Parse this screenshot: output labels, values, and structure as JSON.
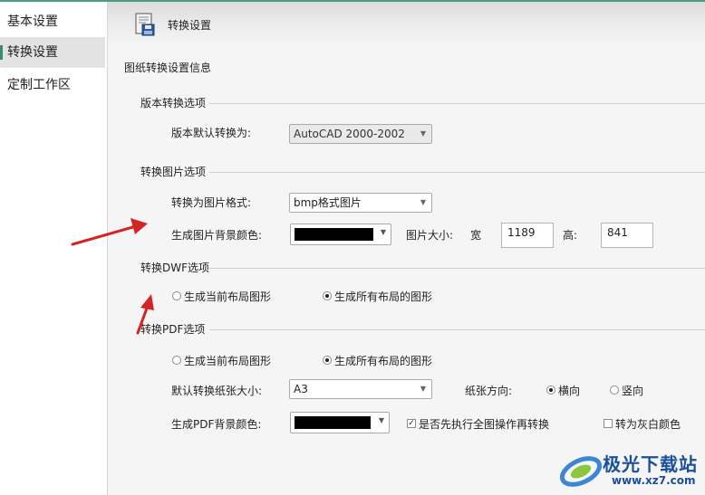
{
  "sidebar": {
    "items": [
      {
        "label": "基本设置",
        "active": false
      },
      {
        "label": "转换设置",
        "active": true
      },
      {
        "label": "定制工作区",
        "active": false
      }
    ]
  },
  "header": {
    "title": "转换设置",
    "icon": "floppy-disk-icon"
  },
  "page": {
    "subtitle": "图纸转换设置信息"
  },
  "version_section": {
    "title": "版本转换选项",
    "default_label": "版本默认转换为:",
    "default_value": "AutoCAD 2000-2002"
  },
  "image_section": {
    "title": "转换图片选项",
    "format_label": "转换为图片格式:",
    "format_value": "bmp格式图片",
    "bg_label": "生成图片背景颜色:",
    "bg_color": "#000000",
    "size_label": "图片大小:",
    "width_label": "宽",
    "width_value": "1189",
    "height_label": "高:",
    "height_value": "841"
  },
  "dwf_section": {
    "title": "转换DWF选项",
    "radio_current": "生成当前布局图形",
    "radio_all": "生成所有布局的图形",
    "selected": "all"
  },
  "pdf_section": {
    "title": "转换PDF选项",
    "radio_current": "生成当前布局图形",
    "radio_all": "生成所有布局的图形",
    "selected": "all",
    "paper_size_label": "默认转换纸张大小:",
    "paper_size_value": "A3",
    "orientation_label": "纸张方向:",
    "orientation_landscape": "横向",
    "orientation_portrait": "竖向",
    "orientation_selected": "landscape",
    "bg_label": "生成PDF背景颜色:",
    "bg_color": "#000000",
    "zoom_all_label": "是否先执行全图操作再转换",
    "zoom_all_checked": true,
    "grayscale_label": "转为灰白颜色",
    "grayscale_checked": false
  },
  "annotations": {
    "arrow_color": "#d42525"
  },
  "watermark": {
    "text": "极光下载站",
    "url": "www.xz7.com"
  }
}
